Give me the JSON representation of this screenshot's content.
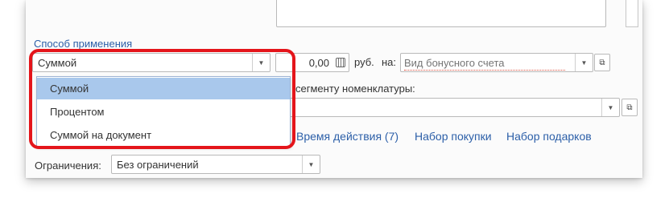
{
  "method": {
    "title": "Способ применения",
    "selected": "Суммой",
    "options": [
      "Суммой",
      "Процентом",
      "Суммой на документ"
    ]
  },
  "amount": {
    "value": "0,00",
    "currency": "руб.",
    "on_label": "на:"
  },
  "bonus_account": {
    "placeholder": "Вид бонусного счета"
  },
  "segment": {
    "label_partial": "сегменту номенклатуры:"
  },
  "links": [
    "Время действия (7)",
    "Набор покупки",
    "Набор подарков"
  ],
  "restrictions": {
    "label": "Ограничения:",
    "value": "Без ограничений"
  },
  "colors": {
    "accent": "#2c5fa8",
    "highlight": "#a9c8ec",
    "annotation": "#e4151b"
  }
}
